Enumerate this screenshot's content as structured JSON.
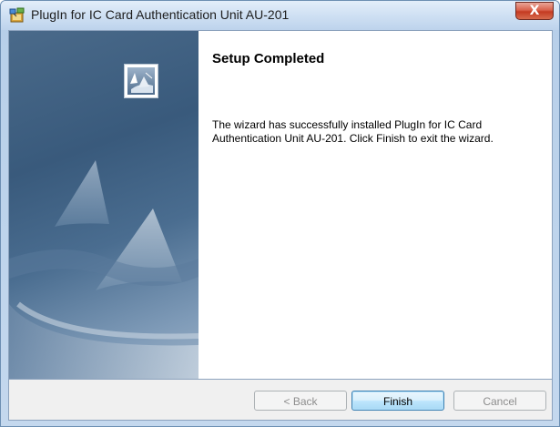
{
  "window": {
    "title": "PlugIn for IC Card Authentication Unit AU-201",
    "close_glyph": "X"
  },
  "content": {
    "heading": "Setup Completed",
    "message": "The wizard has successfully installed PlugIn for IC Card Authentication Unit AU-201. Click Finish to exit the wizard."
  },
  "buttons": {
    "back": "< Back",
    "finish": "Finish",
    "cancel": "Cancel"
  },
  "icons": {
    "title": "installer-icon",
    "banner_logo": "sail-logo-icon"
  },
  "colors": {
    "banner": "#3f6081",
    "accent_button": "#3c7fb1",
    "close_button": "#c43b22"
  }
}
